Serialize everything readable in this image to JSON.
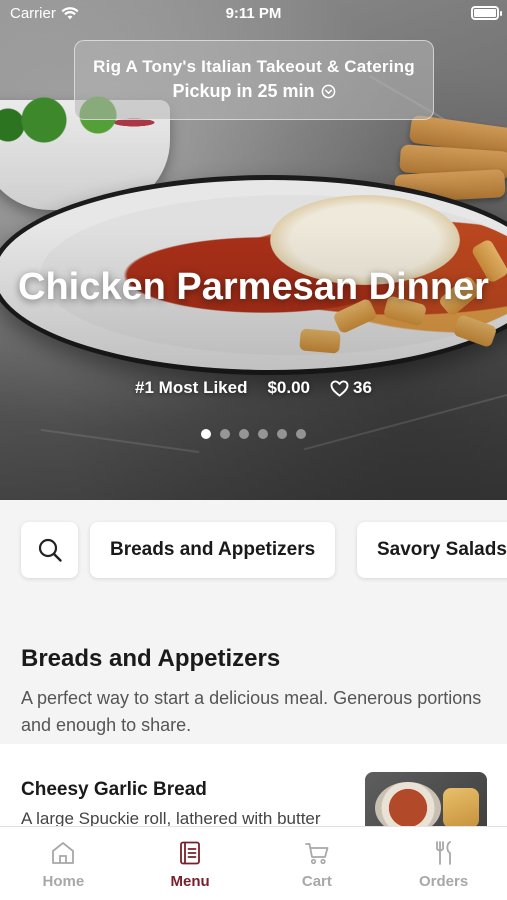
{
  "status_bar": {
    "carrier": "Carrier",
    "time": "9:11 PM"
  },
  "hero": {
    "restaurant_name": "Rig A Tony's Italian Takeout & Catering",
    "pickup_label": "Pickup in 25 min",
    "dish_title": "Chicken Parmesan Dinner",
    "rank_label": "#1 Most Liked",
    "price": "$0.00",
    "likes": "36",
    "carousel": {
      "count": 6,
      "active_index": 0
    }
  },
  "categories": [
    "Breads and Appetizers",
    "Savory Salads"
  ],
  "section": {
    "title": "Breads and Appetizers",
    "description": "A perfect way to start a delicious meal. Generous portions and enough to share."
  },
  "items": [
    {
      "name": "Cheesy Garlic Bread",
      "description": "A large Spuckie roll, lathered with butter"
    }
  ],
  "tab_bar": {
    "tabs": [
      {
        "label": "Home",
        "icon": "home-icon",
        "active": false
      },
      {
        "label": "Menu",
        "icon": "menu-icon",
        "active": true
      },
      {
        "label": "Cart",
        "icon": "cart-icon",
        "active": false
      },
      {
        "label": "Orders",
        "icon": "orders-icon",
        "active": false
      }
    ]
  },
  "colors": {
    "accent": "#7a1f2a",
    "inactive": "#a8a8a8"
  }
}
